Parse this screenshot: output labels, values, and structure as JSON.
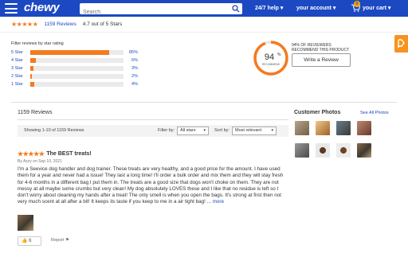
{
  "header": {
    "logo": "chewy",
    "search_placeholder": "Search",
    "help": "24/7 help",
    "account": "your account",
    "cart": "your cart",
    "cart_count": "0"
  },
  "summary": {
    "stars": "★★★★★",
    "reviews_link": "1159 Reviews",
    "rating_text": "4.7 out of 5 Stars"
  },
  "filter": {
    "label": "Filter reviews by star rating",
    "rows": [
      {
        "label": "5 Star",
        "pct": "85%",
        "fraction": 0.85
      },
      {
        "label": "4 Star",
        "pct": "6%",
        "fraction": 0.06
      },
      {
        "label": "3 Star",
        "pct": "3%",
        "fraction": 0.03
      },
      {
        "label": "2 Star",
        "pct": "2%",
        "fraction": 0.02
      },
      {
        "label": "1 Star",
        "pct": "4%",
        "fraction": 0.04
      }
    ]
  },
  "recommend": {
    "percent": "94",
    "percent_sign": "%",
    "ring_label": "RECOMMEND",
    "fraction": 0.94,
    "line1": "94% OF REVIEWERS",
    "line2": "RECOMMEND THIS PRODUCT",
    "write_button": "Write a Review"
  },
  "reviews": {
    "heading": "1159 Reviews",
    "showing": "Showing 1-10 of 1159 Reviews",
    "filter_by_label": "Filter by:",
    "filter_by_value": "All stars",
    "sort_by_label": "Sort by:",
    "sort_by_value": "Most relevant"
  },
  "photos": {
    "heading": "Customer Photos",
    "see_all": "See All Photos"
  },
  "review1": {
    "stars": "★★★★★",
    "title": "The BEST treats!",
    "byline": "By Azzy on Sep 10, 2021",
    "body": "I'm a Seevice dog handler and dog trainer. These treats are very healthy, and a good price for the amount. I have used them for a year and never had a issue! They last a long time! I'll order a bulk order and mix them and they will stay fresh for 4-6 months in a different bag I put them in. The treats are a good size that dogs won't choke on them. They are not messy at all maybe some crumbs but very clean! My dog absolutely LOVES these and I like that no residue is left so I don't worry about cleaning my hands after a treat! The only smell is when you open the bags. It's strong at first then not very much scent at all after a bit! It keeps its taste if you keep to me in a air tight bag! ...",
    "more": "more",
    "helpful_count": "6",
    "report": "Report"
  },
  "colors": {
    "brand_blue": "#1c49c2",
    "accent_orange": "#f47a20"
  }
}
